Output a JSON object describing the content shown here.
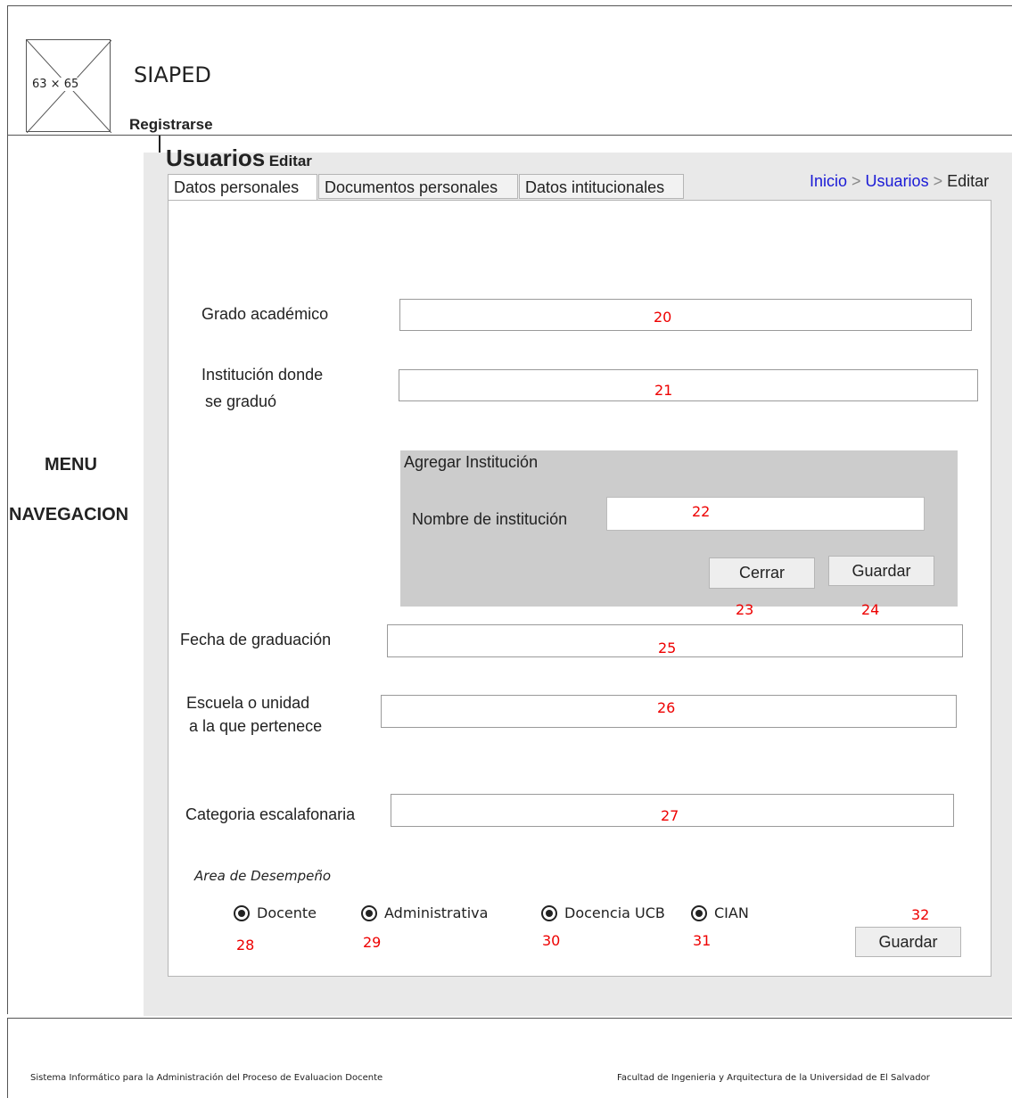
{
  "header": {
    "logo_placeholder": "63 × 65",
    "app_title": "SIAPED",
    "register_link": "Registrarse"
  },
  "nav": {
    "line1": "MENU",
    "line2": "NAVEGACION"
  },
  "page": {
    "title": "Usuarios",
    "subtitle": "Editar"
  },
  "breadcrumb": {
    "home": "Inicio",
    "sep1": " > ",
    "users": "Usuarios",
    "sep2": " > ",
    "current": "Editar"
  },
  "tabs": [
    "Datos personales",
    "Documentos personales",
    "Datos intitucionales"
  ],
  "form": {
    "grado_label": "Grado académico",
    "grado_num": "20",
    "inst_label_1": "Institución donde",
    "inst_label_2": "se graduó",
    "inst_num": "21",
    "add_inst": {
      "title": "Agregar Institución",
      "name_label": "Nombre de institución",
      "name_num": "22",
      "close_label": "Cerrar",
      "close_num": "23",
      "save_label": "Guardar",
      "save_num": "24"
    },
    "fecha_label": "Fecha de graduación",
    "fecha_num": "25",
    "escuela_label_1": "Escuela o unidad",
    "escuela_label_2": "a la que pertenece",
    "escuela_num": "26",
    "categoria_label": "Categoria escalafonaria",
    "categoria_num": "27",
    "area_label": "Area de Desempeño",
    "radios": [
      {
        "label": "Docente",
        "num": "28"
      },
      {
        "label": "Administrativa",
        "num": "29"
      },
      {
        "label": "Docencia UCB",
        "num": "30"
      },
      {
        "label": "CIAN",
        "num": "31"
      }
    ],
    "save_label": "Guardar",
    "save_num": "32"
  },
  "footer": {
    "left": "Sistema Informático para la Administración del Proceso de Evaluacion Docente",
    "right": "Facultad de Ingenieria y Arquitectura de la Universidad de El Salvador"
  }
}
